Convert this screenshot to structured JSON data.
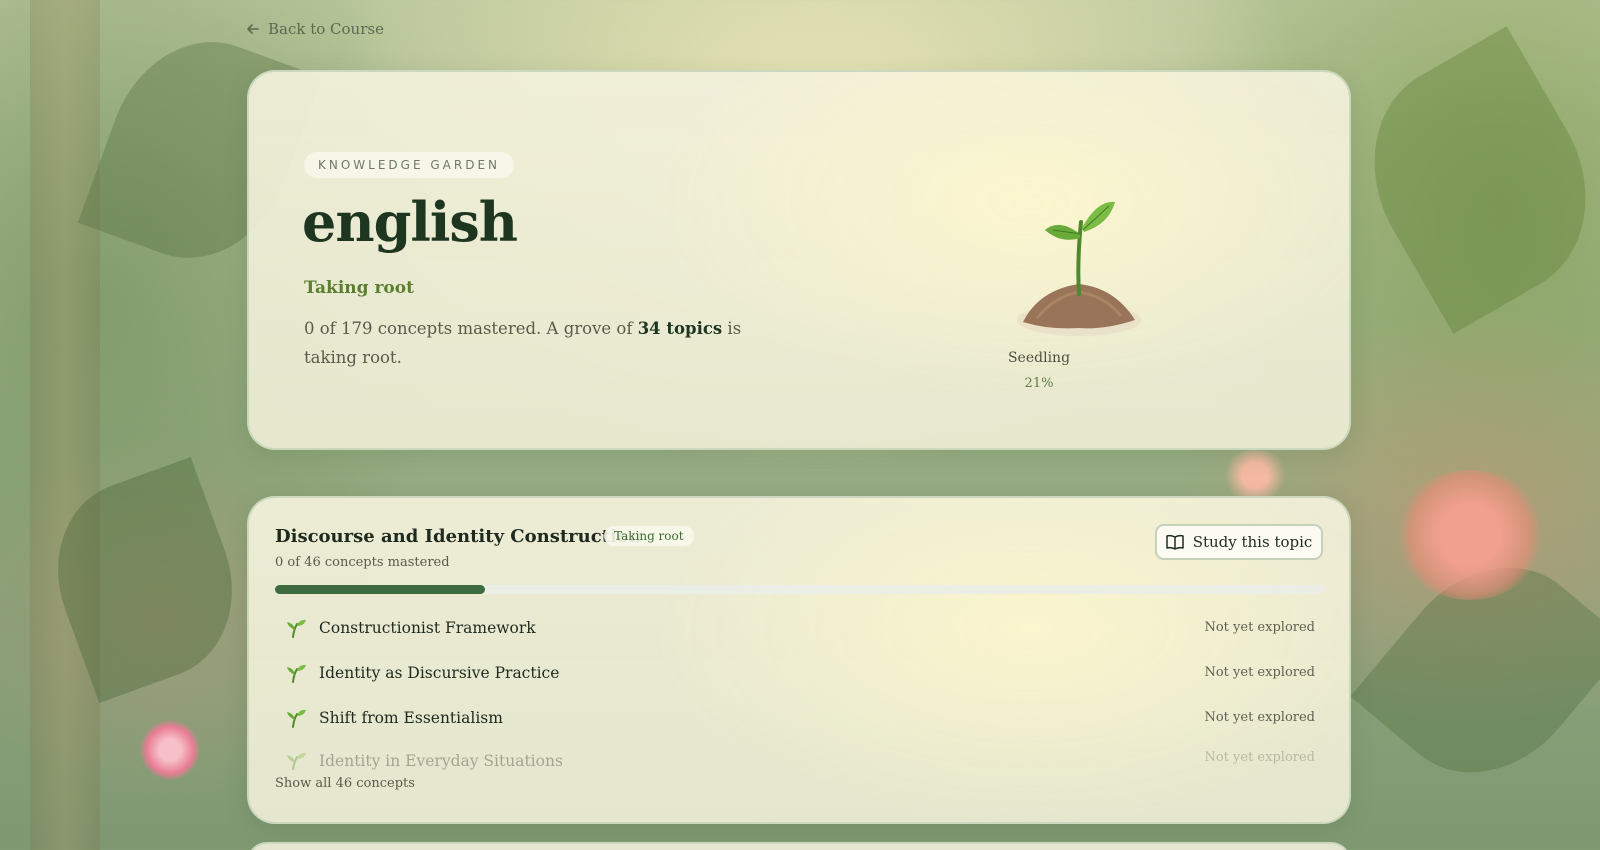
{
  "back_link": {
    "label": "Back to Course",
    "icon": "arrow-left-icon"
  },
  "hero": {
    "eyebrow": "KNOWLEDGE GARDEN",
    "title": "english",
    "status": "Taking root",
    "desc_before": "0 of 179 concepts mastered. A grove of ",
    "desc_bold": "34 topics",
    "desc_after": " is taking root.",
    "plant": {
      "icon": "seedling-illustration",
      "stage": "Seedling",
      "percent_label": "21%",
      "percent": 21
    }
  },
  "topic": {
    "title": "Discourse and Identity Construction",
    "badge": "Taking root",
    "subtitle": "0 of 46 concepts mastered",
    "study_button": {
      "label": "Study this topic",
      "icon": "book-open-icon"
    },
    "progress": 0.2,
    "concepts": [
      {
        "name": "Constructionist Framework",
        "status": "Not yet explored",
        "icon": "sprout-icon"
      },
      {
        "name": "Identity as Discursive Practice",
        "status": "Not yet explored",
        "icon": "sprout-icon"
      },
      {
        "name": "Shift from Essentialism",
        "status": "Not yet explored",
        "icon": "sprout-icon"
      },
      {
        "name": "Identity in Everyday Situations",
        "status": "Not yet explored",
        "icon": "sprout-icon"
      }
    ],
    "show_all": "Show all 46 concepts"
  },
  "colors": {
    "accent_green": "#3e6a40",
    "status_green": "#5b7f2e",
    "card_bg": "#f0eed8"
  }
}
